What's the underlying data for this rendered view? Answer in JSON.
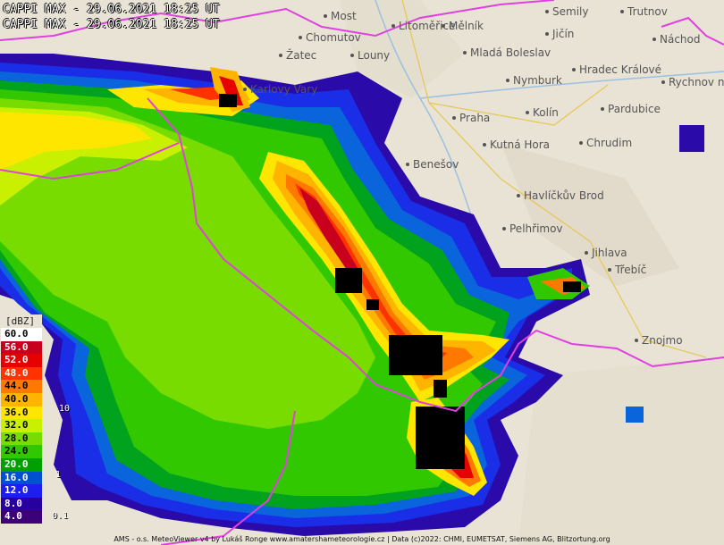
{
  "header": {
    "line1": "CAPPI MAX - 29.06.2021 18:25 UT",
    "line2": "CAPPI MAX - 29.06.2021 18:25 UT"
  },
  "legend": {
    "title": "[dBZ]",
    "levels": [
      {
        "label": "60.0",
        "color": "#ffffff",
        "text": "#000000"
      },
      {
        "label": "56.0",
        "color": "#c8001e",
        "text": "#ffffff"
      },
      {
        "label": "52.0",
        "color": "#e60000",
        "text": "#ffffff"
      },
      {
        "label": "48.0",
        "color": "#ff3200",
        "text": "#ffffff"
      },
      {
        "label": "44.0",
        "color": "#ff7800",
        "text": "#000000"
      },
      {
        "label": "40.0",
        "color": "#ffb400",
        "text": "#000000"
      },
      {
        "label": "36.0",
        "color": "#ffe600",
        "text": "#000000"
      },
      {
        "label": "32.0",
        "color": "#c8f000",
        "text": "#000000"
      },
      {
        "label": "28.0",
        "color": "#78dc00",
        "text": "#000000"
      },
      {
        "label": "24.0",
        "color": "#32c800",
        "text": "#000000"
      },
      {
        "label": "20.0",
        "color": "#00a000",
        "text": "#ffffff"
      },
      {
        "label": "16.0",
        "color": "#0050d2",
        "text": "#ffffff"
      },
      {
        "label": "12.0",
        "color": "#1e1ef0",
        "text": "#ffffff"
      },
      {
        "label": "8.0",
        "color": "#2800a0",
        "text": "#ffffff"
      },
      {
        "label": "4.0",
        "color": "#3c0078",
        "text": "#ffffff"
      }
    ],
    "scale_marks": [
      "10",
      "1",
      "0.1"
    ]
  },
  "cities": [
    {
      "name": "Most"
    },
    {
      "name": "Litoměřice"
    },
    {
      "name": "Semily"
    },
    {
      "name": "Trutnov"
    },
    {
      "name": "Chomutov"
    },
    {
      "name": "Mělník"
    },
    {
      "name": "Jičín"
    },
    {
      "name": "Náchod"
    },
    {
      "name": "Žatec"
    },
    {
      "name": "Louny"
    },
    {
      "name": "Mladá Boleslav"
    },
    {
      "name": "Hradec Králové"
    },
    {
      "name": "Rychnov n"
    },
    {
      "name": "Karlovy Vary"
    },
    {
      "name": "Nymburk"
    },
    {
      "name": "Praha"
    },
    {
      "name": "Kolín"
    },
    {
      "name": "Pardubice"
    },
    {
      "name": "Kutná Hora"
    },
    {
      "name": "Chrudim"
    },
    {
      "name": "Benešov"
    },
    {
      "name": "Havlíčkův Brod"
    },
    {
      "name": "Pelhřimov"
    },
    {
      "name": "Jihlava"
    },
    {
      "name": "Třebíč"
    },
    {
      "name": "Znojmo"
    }
  ],
  "footer": "AMS - o.s. MeteoViewer v4 by Lukáš Ronge www.amatershameteorologie.cz | Data (c)2022: CHMI, EUMETSAT, Siemens AG, Blitzortung.org",
  "colors": {
    "border": "#e040e0",
    "basemap": "#e9e3d6",
    "lightning": "#000000"
  }
}
